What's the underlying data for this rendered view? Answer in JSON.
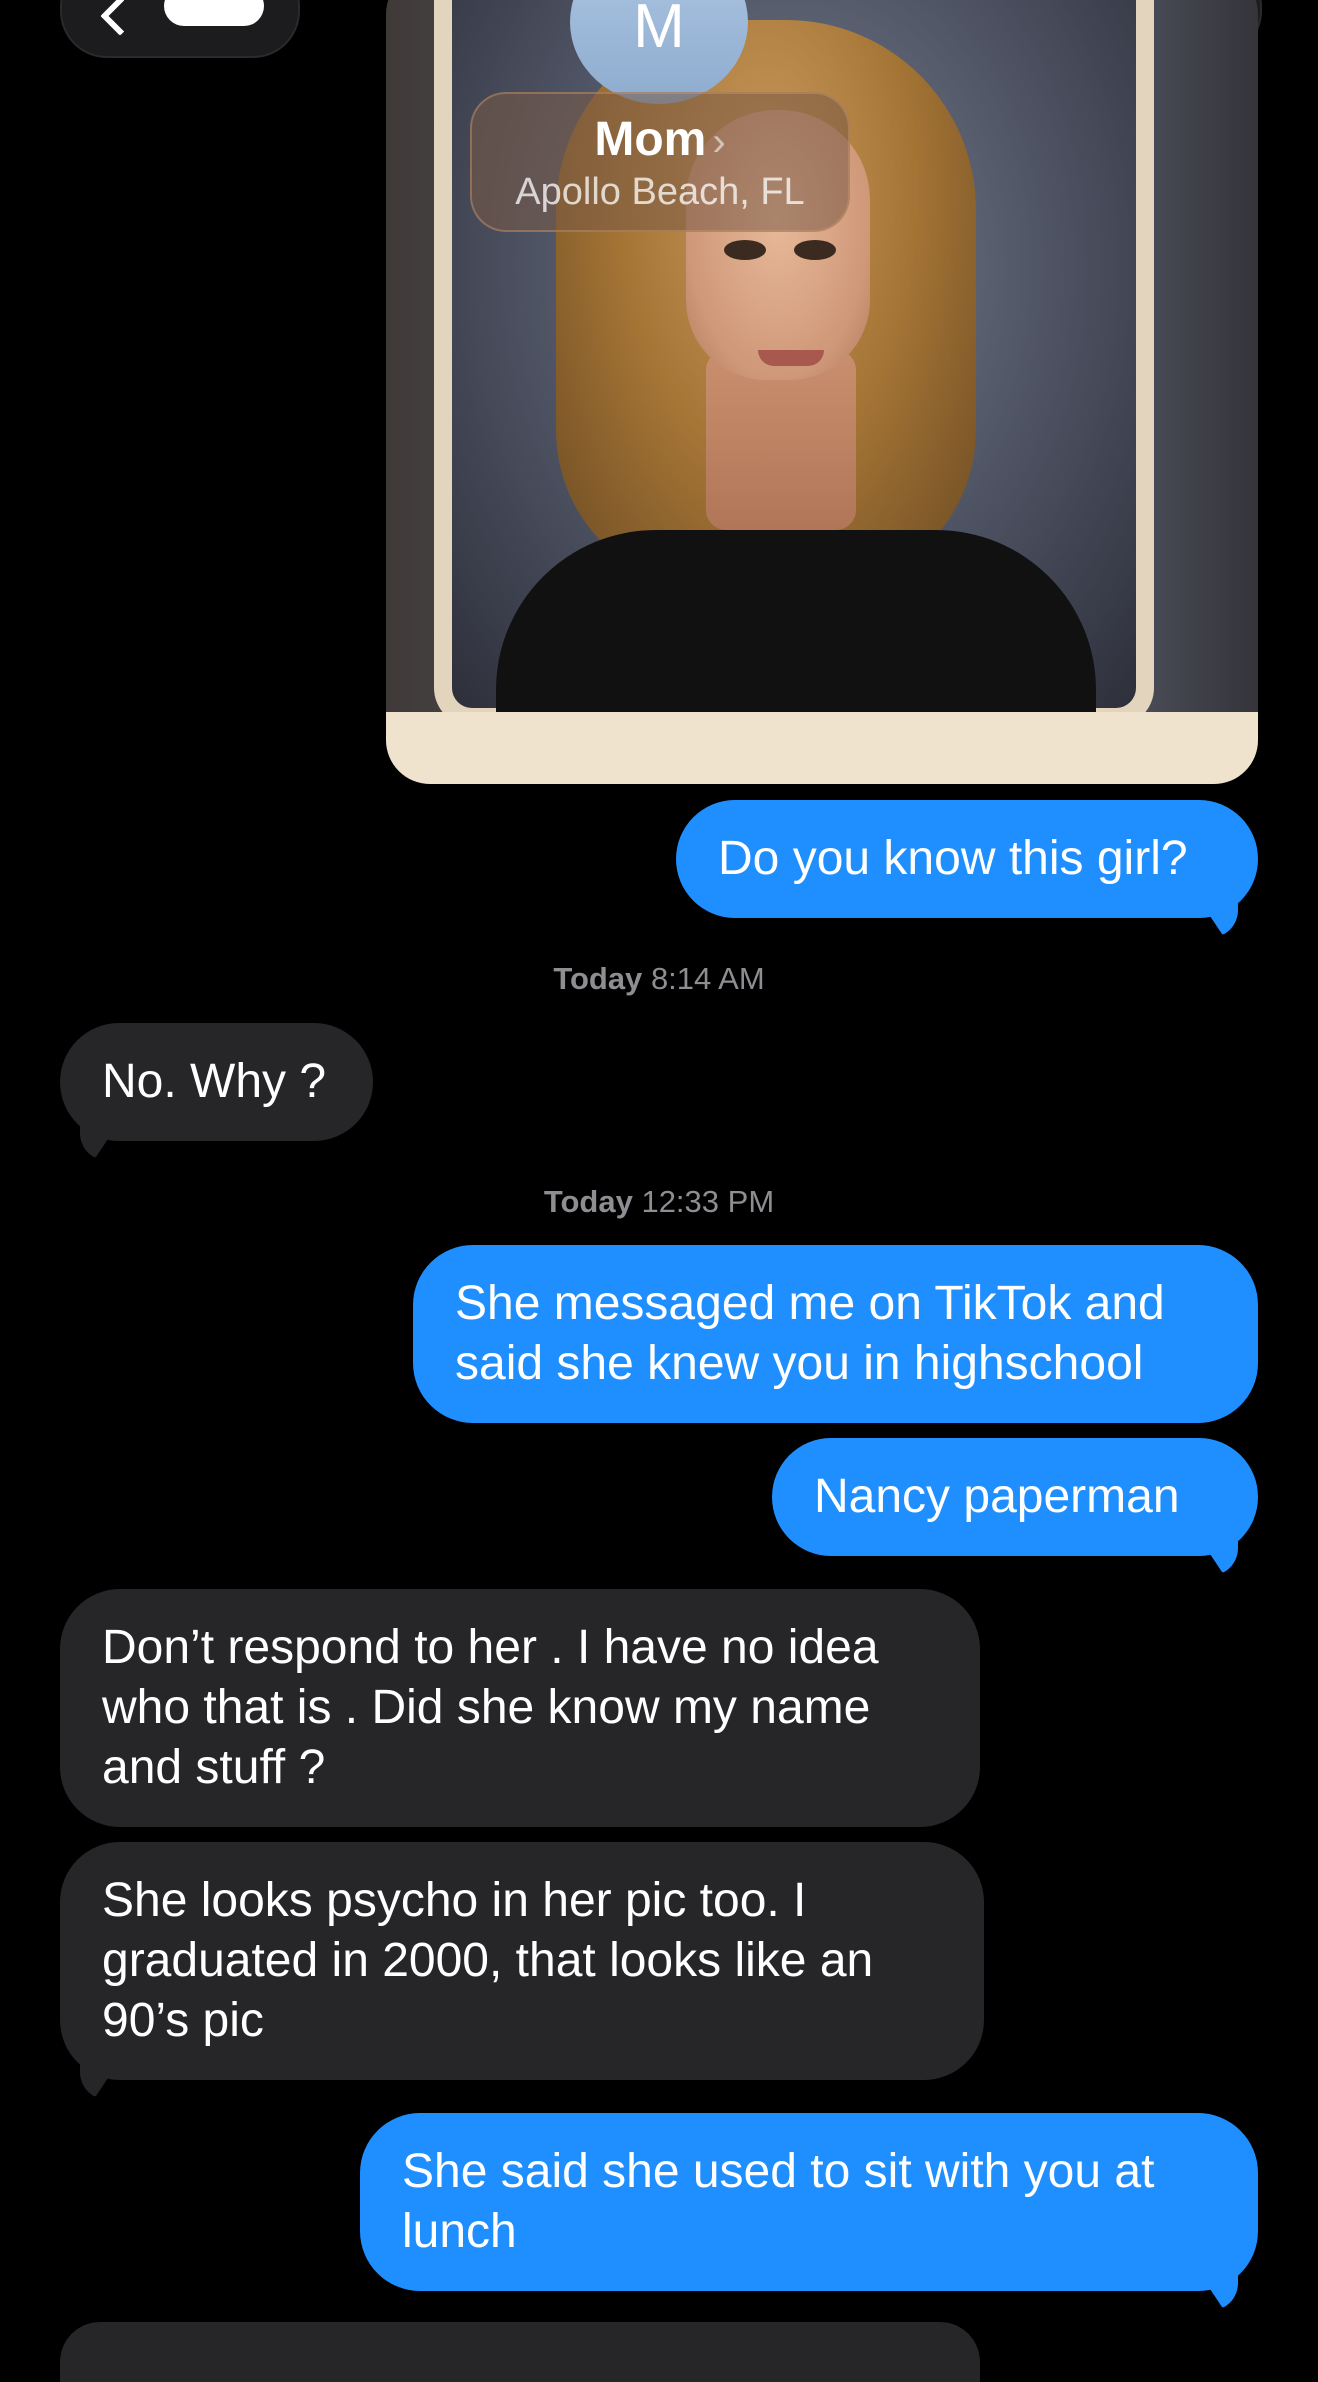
{
  "header": {
    "contact_initial": "M",
    "contact_name": "Mom",
    "contact_location": "Apollo Beach, FL"
  },
  "colors": {
    "outgoing_bubble": "#1f8fff",
    "incoming_bubble": "#262629",
    "background": "#000000"
  },
  "messages": [
    {
      "direction": "outgoing",
      "text": "Do you know this girl?"
    },
    {
      "type": "timestamp",
      "day": "Today",
      "time": "8:14 AM"
    },
    {
      "direction": "incoming",
      "text": "No. Why ?"
    },
    {
      "type": "timestamp",
      "day": "Today",
      "time": "12:33 PM"
    },
    {
      "direction": "outgoing",
      "text": "She messaged me on TikTok and said she knew you in highschool"
    },
    {
      "direction": "outgoing",
      "text": "Nancy paperman"
    },
    {
      "direction": "incoming",
      "text": "Don’t respond to her . I have no idea who that is . Did she know my name and stuff ?"
    },
    {
      "direction": "incoming",
      "text": "She looks psycho in her pic too. I graduated in 2000, that looks like an 90’s pic"
    },
    {
      "direction": "outgoing",
      "text": "She said she used to sit with you at lunch"
    }
  ]
}
